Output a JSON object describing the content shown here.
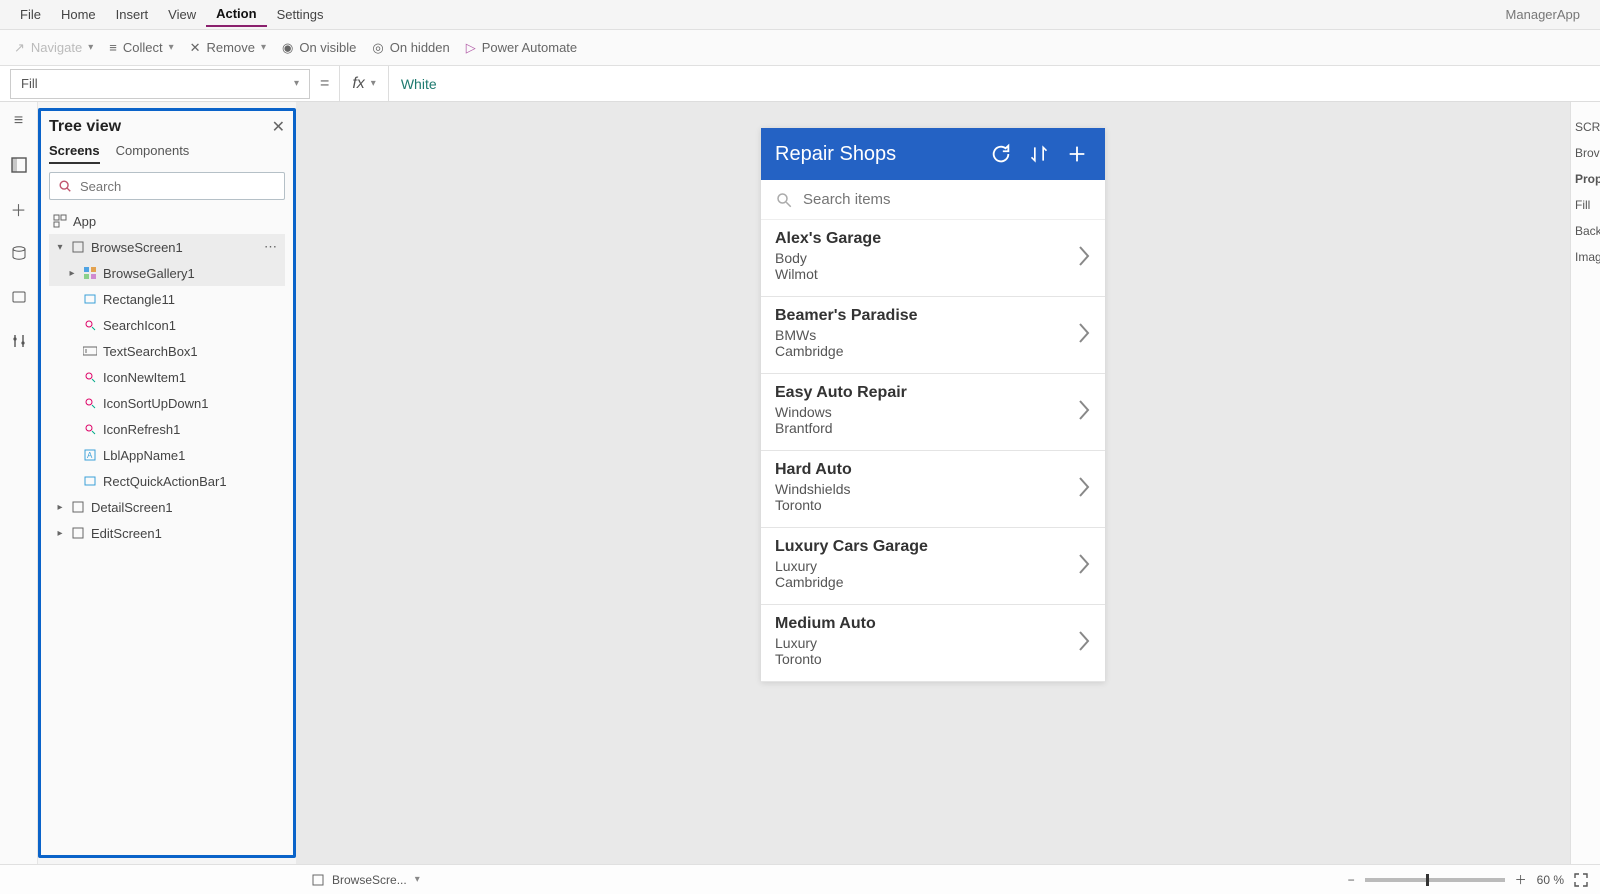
{
  "appName": "ManagerApp",
  "menu": {
    "items": [
      "File",
      "Home",
      "Insert",
      "View",
      "Action",
      "Settings"
    ],
    "active": "Action"
  },
  "ribbon": {
    "navigate": "Navigate",
    "collect": "Collect",
    "remove": "Remove",
    "onVisible": "On visible",
    "onHidden": "On hidden",
    "powerAutomate": "Power Automate"
  },
  "formula": {
    "property": "Fill",
    "fxLabel": "fx",
    "value": "White"
  },
  "treeView": {
    "title": "Tree view",
    "tabs": {
      "screens": "Screens",
      "components": "Components",
      "active": "Screens"
    },
    "searchPlaceholder": "Search",
    "app": "App",
    "nodes": {
      "browseScreen": "BrowseScreen1",
      "browseGallery": "BrowseGallery1",
      "rectangle": "Rectangle11",
      "searchIcon": "SearchIcon1",
      "textSearchBox": "TextSearchBox1",
      "iconNewItem": "IconNewItem1",
      "iconSortUpDown": "IconSortUpDown1",
      "iconRefresh": "IconRefresh1",
      "lblAppName": "LblAppName1",
      "rectQuickActionBar": "RectQuickActionBar1",
      "detailScreen": "DetailScreen1",
      "editScreen": "EditScreen1"
    }
  },
  "preview": {
    "title": "Repair Shops",
    "searchPlaceholder": "Search items",
    "items": [
      {
        "name": "Alex's Garage",
        "specialty": "Body",
        "city": "Wilmot"
      },
      {
        "name": "Beamer's Paradise",
        "specialty": "BMWs",
        "city": "Cambridge"
      },
      {
        "name": "Easy Auto Repair",
        "specialty": "Windows",
        "city": "Brantford"
      },
      {
        "name": "Hard Auto",
        "specialty": "Windshields",
        "city": "Toronto"
      },
      {
        "name": "Luxury Cars Garage",
        "specialty": "Luxury",
        "city": "Cambridge"
      },
      {
        "name": "Medium Auto",
        "specialty": "Luxury",
        "city": "Toronto"
      }
    ]
  },
  "rightPanel": {
    "screenShort": "SCRE",
    "nameShort": "Brov",
    "propShort": "Prop",
    "fill": "Fill",
    "back": "Back",
    "image": "Imag"
  },
  "status": {
    "screen": "BrowseScre...",
    "zoom": "60 %"
  }
}
